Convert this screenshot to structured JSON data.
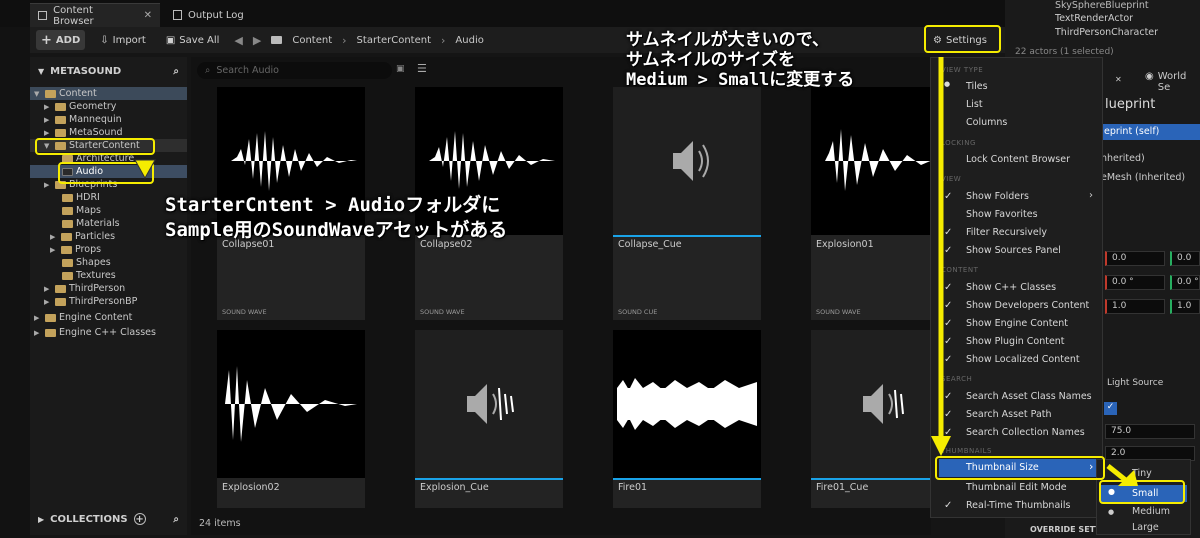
{
  "tabs": {
    "content_browser": "Content Browser",
    "output_log": "Output Log"
  },
  "toolbar": {
    "add": "ADD",
    "import": "Import",
    "save_all": "Save All"
  },
  "breadcrumb": [
    "Content",
    "StarterContent",
    "Audio"
  ],
  "settings_label": "Settings",
  "sidebar": {
    "header": "METASOUND",
    "tree": [
      "Content",
      "Geometry",
      "Mannequin",
      "MetaSound",
      "StarterContent",
      "Architecture",
      "Audio",
      "Blueprints",
      "HDRI",
      "Maps",
      "Materials",
      "Particles",
      "Props",
      "Shapes",
      "Textures",
      "ThirdPerson",
      "ThirdPersonBP",
      "Engine Content",
      "Engine C++ Classes"
    ],
    "collections": "COLLECTIONS"
  },
  "search": {
    "placeholder": "Search Audio"
  },
  "assets": [
    {
      "name": "Collapse01",
      "type": "SOUND WAVE"
    },
    {
      "name": "Collapse02",
      "type": "SOUND WAVE"
    },
    {
      "name": "Collapse_Cue",
      "type": "SOUND CUE"
    },
    {
      "name": "Explosion01",
      "type": "SOUND WAVE"
    },
    {
      "name": "Explosion02",
      "type": ""
    },
    {
      "name": "Explosion_Cue",
      "type": ""
    },
    {
      "name": "Fire01",
      "type": ""
    },
    {
      "name": "Fire01_Cue",
      "type": ""
    }
  ],
  "item_count": "24 items",
  "menu": {
    "sec_view_type": "VIEW TYPE",
    "tiles": "Tiles",
    "list": "List",
    "columns": "Columns",
    "sec_locking": "LOCKING",
    "lock": "Lock Content Browser",
    "sec_view": "VIEW",
    "show_folders": "Show Folders",
    "show_favorites": "Show Favorites",
    "filter_recursively": "Filter Recursively",
    "show_sources": "Show Sources Panel",
    "sec_content": "CONTENT",
    "show_cpp": "Show C++ Classes",
    "show_dev": "Show Developers Content",
    "show_engine": "Show Engine Content",
    "show_plugin": "Show Plugin Content",
    "show_localized": "Show Localized Content",
    "sec_search": "SEARCH",
    "search_class": "Search Asset Class Names",
    "search_path": "Search Asset Path",
    "search_collection": "Search Collection Names",
    "sec_thumbnails": "THUMBNAILS",
    "thumb_size": "Thumbnail Size",
    "thumb_edit": "Thumbnail Edit Mode",
    "realtime": "Real-Time Thumbnails"
  },
  "submenu": {
    "tiny": "Tiny",
    "small": "Small",
    "medium": "Medium",
    "large": "Large"
  },
  "outliner": {
    "items": [
      "SkySphereBlueprint",
      "TextRenderActor",
      "ThirdPersonCharacter"
    ],
    "count": "22 actors (1 selected)"
  },
  "details": {
    "tab_world": "World Se",
    "title": "lueprint",
    "self": "eprint (self)",
    "inherited1": "nherited)",
    "inherited2": "eMesh (Inherited)",
    "vals": [
      "0.0",
      "0.0",
      "0.0 °",
      "0.0 °",
      "1.0",
      "1.0"
    ],
    "light_source": "Light Source",
    "v75": "75.0",
    "v2": "2.0",
    "override": "OVERRIDE SETTI"
  },
  "annotations": {
    "top": [
      "サムネイルが大きいので、",
      "サムネイルのサイズを",
      "Medium > Smallに変更する"
    ],
    "left": [
      "StarterCntent > Audioフォルダに",
      "Sample用のSoundWaveアセットがある"
    ]
  },
  "colors": {
    "highlight": "#f5ec00",
    "accent": "#1aa3e8",
    "selection": "#2a64b8"
  }
}
